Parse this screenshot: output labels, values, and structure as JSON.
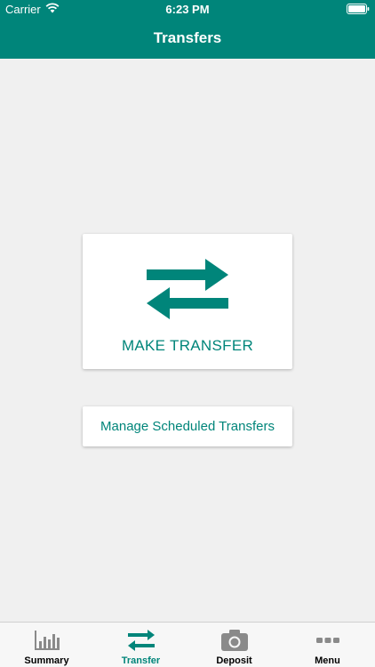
{
  "status_bar": {
    "carrier": "Carrier",
    "time": "6:23 PM"
  },
  "header": {
    "title": "Transfers"
  },
  "main": {
    "make_transfer_label": "MAKE TRANSFER",
    "manage_scheduled_label": "Manage Scheduled Transfers"
  },
  "tabs": [
    {
      "label": "Summary",
      "icon": "bar-chart-icon",
      "active": false
    },
    {
      "label": "Transfer",
      "icon": "transfer-arrows-icon",
      "active": true
    },
    {
      "label": "Deposit",
      "icon": "camera-icon",
      "active": false
    },
    {
      "label": "Menu",
      "icon": "more-dots-icon",
      "active": false
    }
  ],
  "colors": {
    "accent": "#00857a",
    "background": "#f0f0f0",
    "inactive_icon": "#8a8a8a"
  }
}
